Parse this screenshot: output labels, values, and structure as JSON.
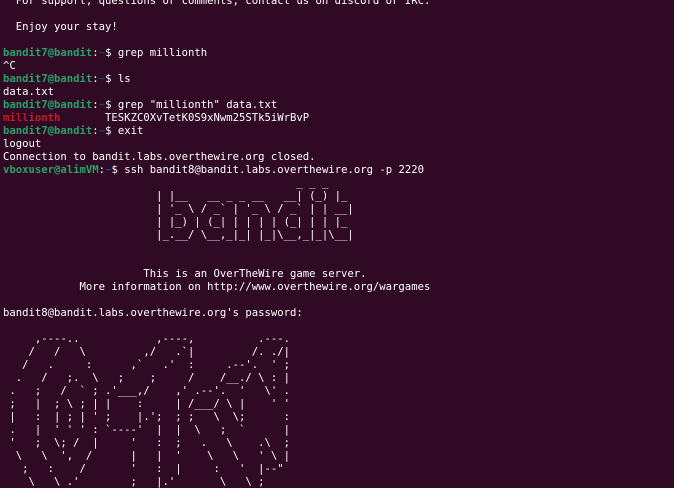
{
  "colors": {
    "background": "#300a24",
    "foreground": "#ffffff",
    "prompt_user": "#26a269",
    "prompt_path": "#12488b",
    "grep_match": "#c01c28"
  },
  "lines": [
    "  For support, questions or comments, contact us on discord or IRC.",
    "",
    "  Enjoy your stay!",
    "",
    {
      "prompt": {
        "user": "bandit7@bandit",
        "path": "~",
        "symbol": "$"
      },
      "command": " grep millionth"
    },
    "^C",
    {
      "prompt": {
        "user": "bandit7@bandit",
        "path": "~",
        "symbol": "$"
      },
      "command": " ls"
    },
    "data.txt",
    {
      "prompt": {
        "user": "bandit7@bandit",
        "path": "~",
        "symbol": "$"
      },
      "command": " grep \"millionth\" data.txt"
    },
    {
      "match": "millionth",
      "rest": "       TESKZC0XvTetK0S9xNwm25STk5iWrBvP"
    },
    {
      "prompt": {
        "user": "bandit7@bandit",
        "path": "~",
        "symbol": "$"
      },
      "command": " exit"
    },
    "logout",
    "Connection to bandit.labs.overthewire.org closed.",
    {
      "prompt": {
        "user": "vboxuser@alimVM",
        "path": "~",
        "symbol": "$"
      },
      "command": " ssh bandit8@bandit.labs.overthewire.org -p 2220"
    },
    "                                              _ _ _   ",
    "                        | |__   __ _ _ __   __| (_) |_ ",
    "                        | '_ \\ / _` | '_ \\ / _` | | __|",
    "                        | |_) | (_| | | | | (_| | | |_ ",
    "                        |_.__/ \\__,_|_| |_|\\__,_|_|\\__|",
    "",
    "",
    "                      This is an OverTheWire game server.",
    "            More information on http://www.overthewire.org/wargames",
    "",
    "bandit8@bandit.labs.overthewire.org's password:",
    "",
    "     ,----..            ,----,          .---.",
    "    /   /   \\         ,/   .`|         /. ./|",
    "   /   .     :      ,`   .'  :     .--'.  ' ;",
    "  .   /   ;.  \\   ;    ;     /    /__./ \\ : |",
    " .   ;   /  ` ; .'___,/    ,' .--'.  '   \\' .",
    " ;   |  ; \\ ; | |    :     | /___/ \\ |    ' '",
    " |   :  | ; | ' ;    |.';  ; ;   \\  \\;      :",
    " .   |  ' ' ' : `----'  |  |  \\   ;  `      |",
    " '   ;  \\; /  |     '   :  ;   .   \\    .\\  ;",
    "  \\   \\  ',  /      |   |  '    \\   \\   ' \\ |",
    "   ;   :    /       '   :  |     :   '  |--\"",
    "    \\   \\ .'        ;   |.'       \\   \\ ;"
  ]
}
